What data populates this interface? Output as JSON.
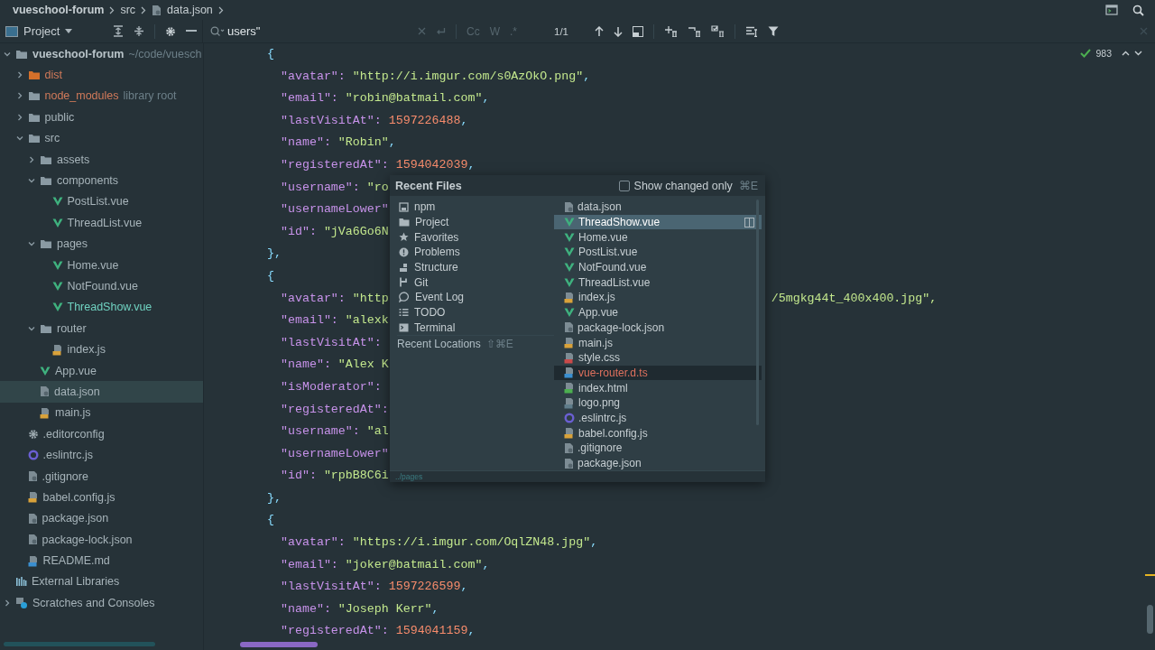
{
  "breadcrumb": [
    {
      "label": "vueschool-forum",
      "kind": "project"
    },
    {
      "label": "src",
      "kind": "folder"
    },
    {
      "label": "data.json",
      "kind": "json"
    }
  ],
  "project_panel": {
    "title": "Project"
  },
  "find_bar": {
    "value": "users\"",
    "options": [
      {
        "label": "Cc",
        "on": false
      },
      {
        "label": "W",
        "on": false
      },
      {
        "label": ".*",
        "on": false
      }
    ],
    "match_count": "1/1"
  },
  "sidebar": {
    "tree": [
      {
        "label": "vueschool-forum",
        "note": "~/code/vuesch",
        "kind": "project",
        "excluded": false,
        "added": false,
        "selected": false,
        "expanded": true,
        "children": [
          {
            "label": "dist",
            "kind": "output-folder",
            "excluded": true,
            "added": false,
            "selected": false,
            "expanded": false
          },
          {
            "label": "node_modules",
            "note": "library root",
            "kind": "folder",
            "excluded": true,
            "added": false,
            "selected": false,
            "expanded": false
          },
          {
            "label": "public",
            "kind": "folder",
            "excluded": false,
            "added": false,
            "selected": false,
            "expanded": false
          },
          {
            "label": "src",
            "kind": "folder",
            "excluded": false,
            "added": false,
            "selected": false,
            "expanded": true,
            "children": [
              {
                "label": "assets",
                "kind": "folder",
                "excluded": false,
                "added": false,
                "selected": false,
                "expanded": false
              },
              {
                "label": "components",
                "kind": "folder",
                "excluded": false,
                "added": false,
                "selected": false,
                "expanded": true,
                "children": [
                  {
                    "label": "PostList.vue",
                    "kind": "vue",
                    "excluded": false,
                    "added": false,
                    "selected": false
                  },
                  {
                    "label": "ThreadList.vue",
                    "kind": "vue",
                    "excluded": false,
                    "added": false,
                    "selected": false
                  }
                ]
              },
              {
                "label": "pages",
                "kind": "folder",
                "excluded": false,
                "added": false,
                "selected": false,
                "expanded": true,
                "children": [
                  {
                    "label": "Home.vue",
                    "kind": "vue",
                    "excluded": false,
                    "added": false,
                    "selected": false
                  },
                  {
                    "label": "NotFound.vue",
                    "kind": "vue",
                    "excluded": false,
                    "added": false,
                    "selected": false
                  },
                  {
                    "label": "ThreadShow.vue",
                    "kind": "vue",
                    "excluded": false,
                    "added": true,
                    "selected": false
                  }
                ]
              },
              {
                "label": "router",
                "kind": "folder",
                "excluded": false,
                "added": false,
                "selected": false,
                "expanded": true,
                "children": [
                  {
                    "label": "index.js",
                    "kind": "js",
                    "excluded": false,
                    "added": false,
                    "selected": false
                  }
                ]
              },
              {
                "label": "App.vue",
                "kind": "vue",
                "excluded": false,
                "added": false,
                "selected": false
              },
              {
                "label": "data.json",
                "kind": "json",
                "excluded": false,
                "added": false,
                "selected": true
              },
              {
                "label": "main.js",
                "kind": "js",
                "excluded": false,
                "added": false,
                "selected": false
              }
            ]
          },
          {
            "label": ".editorconfig",
            "kind": "config",
            "excluded": false,
            "added": false,
            "selected": false
          },
          {
            "label": ".eslintrc.js",
            "kind": "eslint",
            "excluded": false,
            "added": false,
            "selected": false
          },
          {
            "label": ".gitignore",
            "kind": "json",
            "excluded": false,
            "added": false,
            "selected": false
          },
          {
            "label": "babel.config.js",
            "kind": "js",
            "excluded": false,
            "added": false,
            "selected": false
          },
          {
            "label": "package.json",
            "kind": "json",
            "excluded": false,
            "added": false,
            "selected": false
          },
          {
            "label": "package-lock.json",
            "kind": "json",
            "excluded": false,
            "added": false,
            "selected": false
          },
          {
            "label": "README.md",
            "kind": "md",
            "excluded": false,
            "added": false,
            "selected": false
          }
        ]
      },
      {
        "label": "External Libraries",
        "kind": "libraries",
        "excluded": false,
        "added": false,
        "selected": false
      },
      {
        "label": "Scratches and Consoles",
        "kind": "scratches",
        "excluded": false,
        "added": false,
        "selected": false,
        "expanded": false
      }
    ]
  },
  "editor": {
    "lines": [
      {
        "kind": "brace",
        "text": "{"
      },
      {
        "kind": "string",
        "key": "\"avatar\":",
        "value": "\"http://i.imgur.com/s0AzOkO.png\"",
        "end": ","
      },
      {
        "kind": "string",
        "key": "\"email\":",
        "value": "\"robin@batmail.com\"",
        "end": ","
      },
      {
        "kind": "number",
        "key": "\"lastVisitAt\":",
        "value": "1597226488",
        "end": ","
      },
      {
        "kind": "string",
        "key": "\"name\":",
        "value": "\"Robin\"",
        "end": ","
      },
      {
        "kind": "number",
        "key": "\"registeredAt\":",
        "value": "1594042039",
        "end": ","
      },
      {
        "kind": "string",
        "key": "\"username\":",
        "value": "\"ro"
      },
      {
        "kind": "key",
        "key": "\"usernameLower\""
      },
      {
        "kind": "string",
        "key": "\"id\":",
        "value": "\"jVa6Go6N"
      },
      {
        "kind": "brace",
        "text": "},"
      },
      {
        "kind": "brace",
        "text": "{"
      },
      {
        "kind": "string",
        "key": "\"avatar\":",
        "value": "\"http",
        "tail": "/5mgkg44t_400x400.jpg\","
      },
      {
        "kind": "string",
        "key": "\"email\":",
        "value": "\"alexk"
      },
      {
        "kind": "key",
        "key": "\"lastVisitAt\":"
      },
      {
        "kind": "string",
        "key": "\"name\":",
        "value": "\"Alex K"
      },
      {
        "kind": "key",
        "key": "\"isModerator\":"
      },
      {
        "kind": "key",
        "key": "\"registeredAt\":"
      },
      {
        "kind": "string",
        "key": "\"username\":",
        "value": "\"al"
      },
      {
        "kind": "key",
        "key": "\"usernameLower\""
      },
      {
        "kind": "string",
        "key": "\"id\":",
        "value": "\"rpbB8C6i"
      },
      {
        "kind": "brace",
        "text": "},"
      },
      {
        "kind": "brace",
        "text": "{"
      },
      {
        "kind": "string",
        "key": "\"avatar\":",
        "value": "\"https://i.imgur.com/OqlZN48.jpg\"",
        "end": ","
      },
      {
        "kind": "string",
        "key": "\"email\":",
        "value": "\"joker@batmail.com\"",
        "end": ","
      },
      {
        "kind": "number",
        "key": "\"lastVisitAt\":",
        "value": "1597226599",
        "end": ","
      },
      {
        "kind": "string",
        "key": "\"name\":",
        "value": "\"Joseph Kerr\"",
        "end": ","
      },
      {
        "kind": "number",
        "key": "\"registeredAt\":",
        "value": "1594041159",
        "end": ","
      }
    ],
    "inspection_count": "983"
  },
  "recent_files": {
    "title": "Recent Files",
    "show_changed_only": {
      "label": "Show changed only",
      "shortcut": "⌘E",
      "checked": false
    },
    "tool_windows": [
      {
        "label": "npm",
        "kind": "npm"
      },
      {
        "label": "Project",
        "kind": "folder"
      },
      {
        "label": "Favorites",
        "kind": "star"
      },
      {
        "label": "Problems",
        "kind": "problems"
      },
      {
        "label": "Structure",
        "kind": "structure"
      },
      {
        "label": "Git",
        "kind": "git"
      },
      {
        "label": "Event Log",
        "kind": "log"
      },
      {
        "label": "TODO",
        "kind": "todo"
      },
      {
        "label": "Terminal",
        "kind": "terminal"
      }
    ],
    "recent_locations": {
      "label": "Recent Locations",
      "shortcut": "⇧⌘E"
    },
    "files": [
      {
        "label": "data.json",
        "kind": "json",
        "selected": false,
        "excluded": false
      },
      {
        "label": "ThreadShow.vue",
        "kind": "vue",
        "selected": true,
        "excluded": false
      },
      {
        "label": "Home.vue",
        "kind": "vue",
        "selected": false,
        "excluded": false
      },
      {
        "label": "PostList.vue",
        "kind": "vue",
        "selected": false,
        "excluded": false
      },
      {
        "label": "NotFound.vue",
        "kind": "vue",
        "selected": false,
        "excluded": false
      },
      {
        "label": "ThreadList.vue",
        "kind": "vue",
        "selected": false,
        "excluded": false
      },
      {
        "label": "index.js",
        "kind": "js",
        "selected": false,
        "excluded": false
      },
      {
        "label": "App.vue",
        "kind": "vue",
        "selected": false,
        "excluded": false
      },
      {
        "label": "package-lock.json",
        "kind": "json",
        "selected": false,
        "excluded": false
      },
      {
        "label": "main.js",
        "kind": "js",
        "selected": false,
        "excluded": false
      },
      {
        "label": "style.css",
        "kind": "css",
        "selected": false,
        "excluded": false
      },
      {
        "label": "vue-router.d.ts",
        "kind": "ts",
        "selected": false,
        "excluded": true
      },
      {
        "label": "index.html",
        "kind": "html",
        "selected": false,
        "excluded": false
      },
      {
        "label": "logo.png",
        "kind": "png",
        "selected": false,
        "excluded": false
      },
      {
        "label": ".eslintrc.js",
        "kind": "eslint",
        "selected": false,
        "excluded": false
      },
      {
        "label": "babel.config.js",
        "kind": "js",
        "selected": false,
        "excluded": false
      },
      {
        "label": ".gitignore",
        "kind": "json",
        "selected": false,
        "excluded": false
      },
      {
        "label": "package.json",
        "kind": "json",
        "selected": false,
        "excluded": false
      }
    ],
    "path": "../pages"
  }
}
